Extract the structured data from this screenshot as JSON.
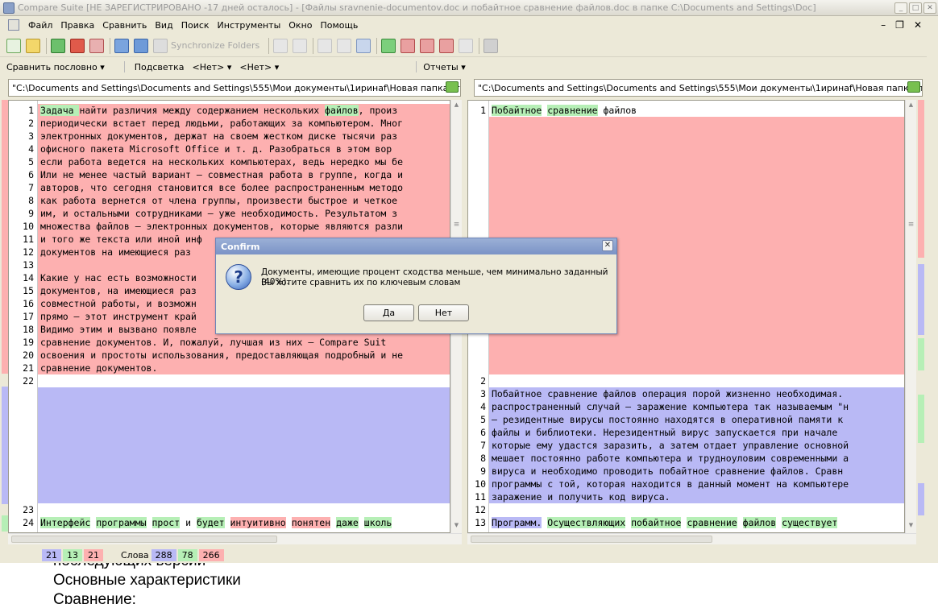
{
  "window": {
    "title": "Compare Suite [НЕ ЗАРЕГИСТРИРОВАНО -17 дней осталось] - [Файлы sravnenie-documentov.doc и побайтное сравнение файлов.doc в папке C:\\Documents and Settings\\Doc]"
  },
  "menu": [
    "Файл",
    "Правка",
    "Сравнить",
    "Вид",
    "Поиск",
    "Инструменты",
    "Окно",
    "Помощь"
  ],
  "toolbar": {
    "sync_label": "Synchronize Folders"
  },
  "options": {
    "compare_mode": "Сравнить пословно ▾",
    "highlight_label": "Подсветка",
    "highlight1": "<Нет> ▾",
    "highlight2": "<Нет> ▾",
    "reports": "Отчеты ▾"
  },
  "left": {
    "path": "\"C:\\Documents and Settings\\Documents and Settings\\555\\Мои документы\\1иринаf\\Новая папка\\sravnenie-d",
    "lines": [
      "Задача   найти различия между содержанием нескольких файлов, произ",
      "периодически встает перед людьми, работающих за компьютером. Мног",
      "электронных  документов, держат на своем жестком диске тысячи раз",
      "офисного пакета Microsoft Office  и т. д.  Разобраться в этом вор",
      "если работа ведется на нескольких компьютерах, ведь нередко мы бе",
      "Или не менее частый вариант – совместная работа в группе, когда и",
      "авторов, что сегодня становится все более распространенным методо",
      "как работа вернется от члена группы, произвести быстрое и четкое ",
      "им,  и остальными сотрудниками – уже необходимость. Результатом з",
      "множества файлов – электронных документов, которые являются разли",
      "и того же текста или иной инф",
      "документов  на имеющиеся раз",
      "",
      "Какие у нас есть возможности",
      "документов, на имеющиеся раз",
      "совместной работы, и возможн",
      "прямо – этот инструмент край",
      "Видимо этим и вызвано появле",
      "сравнение документов.   И, пожалуй,  лучшая из них – Compare Suit",
      "освоения и простоты использования, предоставляющая подробный и не",
      "сравнение документов."
    ],
    "line_numbers": [
      "1",
      "2",
      "3",
      "4",
      "5",
      "6",
      "7",
      "8",
      "9",
      "10",
      "11",
      "12",
      "13",
      "14",
      "15",
      "16",
      "17",
      "18",
      "19",
      "20",
      "21",
      "22",
      "23",
      "24"
    ],
    "line24": [
      "Интерфейс",
      "программы",
      "прост",
      "и",
      "будет",
      "интуитивно",
      "понятен",
      "даже",
      "школь"
    ]
  },
  "right": {
    "path": "\"C:\\Documents and Settings\\Documents and Settings\\555\\Мои документы\\1иринаf\\Новая папка\\побайтное",
    "line1": [
      "Побайтное",
      "сравнение",
      "файлов"
    ],
    "lines": [
      "Побайтное сравнение файлов операция порой жизненно необходимая.",
      "распространенный случай – заражение компьютера так называемым \"н",
      "– резидентные вирусы  постоянно находятся в оперативной памяти к",
      "файлы и библиотеки. Нерезидентный вирус  запускается при начале",
      "которые ему удастся заразить, а затем отдает управление основной",
      "мешает постоянно работе компьютера и трудноуловим современными а",
      "вируса и необходимо проводить побайтное сравнение файлов.  Сравн",
      "программы с той, которая находится в данный момент на компьютере",
      "заражение и получить код вируса."
    ],
    "line_numbers": [
      "1",
      "2",
      "3",
      "4",
      "5",
      "6",
      "7",
      "8",
      "9",
      "10",
      "11",
      "12",
      "13"
    ],
    "line13": [
      "Программ.",
      "Осуществляющих",
      "побайтное",
      "сравнение",
      "файлов",
      "существует"
    ]
  },
  "status": {
    "c1": "21",
    "c2": "13",
    "c3": "21",
    "words_label": "Слова",
    "w1": "288",
    "w2": "78",
    "w3": "266"
  },
  "dialog": {
    "title": "Confirm",
    "message1": "Документы, имеющие процент сходства меньше, чем минимально заданный (40%).",
    "message2": "Вы хотите сравнить их по ключевым словам",
    "yes": "Да",
    "no": "Нет"
  },
  "document_below": {
    "line1": "последующих версий",
    "line2": "Основные характеристики",
    "line3": "Сравнение:"
  }
}
